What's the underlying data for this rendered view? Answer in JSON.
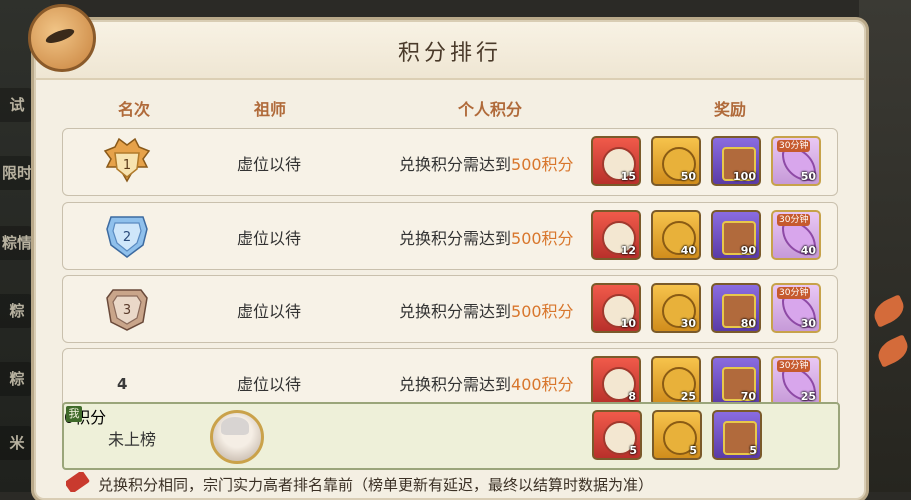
{
  "background": {
    "left_tabs": [
      "试",
      "限时",
      "粽情",
      "粽",
      "粽",
      "米"
    ]
  },
  "panel": {
    "title": "积分排行"
  },
  "columns": {
    "rank": "名次",
    "founder": "祖师",
    "score": "个人积分",
    "reward": "奖励"
  },
  "rows": [
    {
      "rank": "1",
      "founder": "虚位以待",
      "score_prefix": "兑换积分需达到",
      "score_value": "500积分",
      "rewards": [
        {
          "icon": "red-bag-icon",
          "qty": "15"
        },
        {
          "icon": "gold-tiger-icon",
          "qty": "50"
        },
        {
          "icon": "purple-chest-icon",
          "qty": "100"
        },
        {
          "icon": "violet-scroll-icon",
          "tag": "30分钟",
          "qty": "50"
        }
      ]
    },
    {
      "rank": "2",
      "founder": "虚位以待",
      "score_prefix": "兑换积分需达到",
      "score_value": "500积分",
      "rewards": [
        {
          "icon": "red-bag-icon",
          "qty": "12"
        },
        {
          "icon": "gold-tiger-icon",
          "qty": "40"
        },
        {
          "icon": "purple-chest-icon",
          "qty": "90"
        },
        {
          "icon": "violet-scroll-icon",
          "tag": "30分钟",
          "qty": "40"
        }
      ]
    },
    {
      "rank": "3",
      "founder": "虚位以待",
      "score_prefix": "兑换积分需达到",
      "score_value": "500积分",
      "rewards": [
        {
          "icon": "red-bag-icon",
          "qty": "10"
        },
        {
          "icon": "gold-tiger-icon",
          "qty": "30"
        },
        {
          "icon": "purple-chest-icon",
          "qty": "80"
        },
        {
          "icon": "violet-scroll-icon",
          "tag": "30分钟",
          "qty": "30"
        }
      ]
    },
    {
      "rank": "4",
      "founder": "虚位以待",
      "score_prefix": "兑换积分需达到",
      "score_value": "400积分",
      "rewards": [
        {
          "icon": "red-bag-icon",
          "qty": "8"
        },
        {
          "icon": "gold-tiger-icon",
          "qty": "25"
        },
        {
          "icon": "purple-chest-icon",
          "qty": "70"
        },
        {
          "icon": "violet-scroll-icon",
          "tag": "30分钟",
          "qty": "25"
        }
      ]
    }
  ],
  "my_rank": {
    "corner": "我",
    "label": "未上榜",
    "score": "0积分",
    "rewards": [
      {
        "icon": "red-bag-icon",
        "qty": "5"
      },
      {
        "icon": "gold-tiger-icon",
        "qty": "5"
      },
      {
        "icon": "purple-chest-icon",
        "qty": "5"
      }
    ]
  },
  "footer": {
    "text": "兑换积分相同，宗门实力高者排名靠前（榜单更新有延迟，最终以结算时数据为准）"
  },
  "colors": {
    "accent": "#d8762c",
    "header_text": "#b06a3a"
  }
}
